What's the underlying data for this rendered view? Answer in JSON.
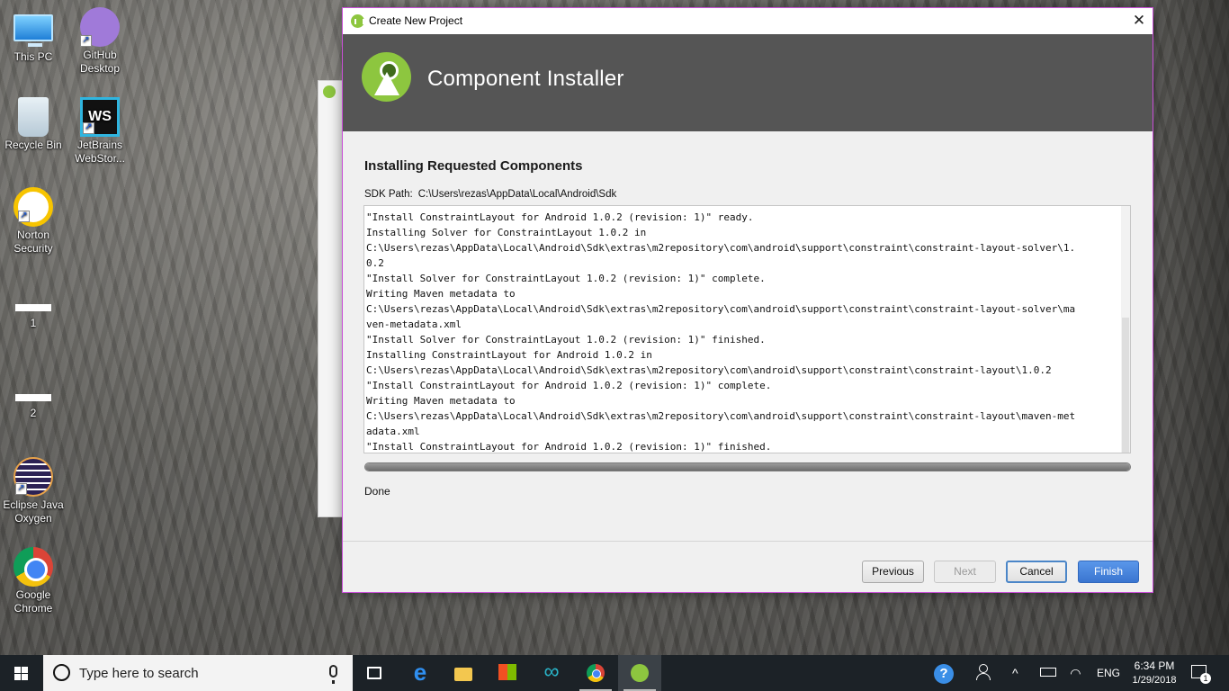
{
  "desktop": {
    "icons": [
      {
        "label": "This PC"
      },
      {
        "label": "GitHub Desktop"
      },
      {
        "label": "Recycle Bin"
      },
      {
        "label": "JetBrains WebStor..."
      },
      {
        "label": "Norton Security"
      },
      {
        "label": "1"
      },
      {
        "label": "2"
      },
      {
        "label": "Eclipse Java Oxygen"
      },
      {
        "label": "Google Chrome"
      }
    ]
  },
  "dialog": {
    "window_title": "Create New Project",
    "close_glyph": "✕",
    "banner_title": "Component Installer",
    "heading": "Installing Requested Components",
    "sdk_label": "SDK Path:",
    "sdk_path": "C:\\Users\\rezas\\AppData\\Local\\Android\\Sdk",
    "log_lines": [
      "\"Install ConstraintLayout for Android 1.0.2 (revision: 1)\" ready.",
      "Installing Solver for ConstraintLayout 1.0.2 in",
      "C:\\Users\\rezas\\AppData\\Local\\Android\\Sdk\\extras\\m2repository\\com\\android\\support\\constraint\\constraint-layout-solver\\1.",
      "0.2",
      "\"Install Solver for ConstraintLayout 1.0.2 (revision: 1)\" complete.",
      "Writing Maven metadata to",
      "C:\\Users\\rezas\\AppData\\Local\\Android\\Sdk\\extras\\m2repository\\com\\android\\support\\constraint\\constraint-layout-solver\\ma",
      "ven-metadata.xml",
      "\"Install Solver for ConstraintLayout 1.0.2 (revision: 1)\" finished.",
      "Installing ConstraintLayout for Android 1.0.2 in",
      "C:\\Users\\rezas\\AppData\\Local\\Android\\Sdk\\extras\\m2repository\\com\\android\\support\\constraint\\constraint-layout\\1.0.2",
      "\"Install ConstraintLayout for Android 1.0.2 (revision: 1)\" complete.",
      "Writing Maven metadata to",
      "C:\\Users\\rezas\\AppData\\Local\\Android\\Sdk\\extras\\m2repository\\com\\android\\support\\constraint\\constraint-layout\\maven-met",
      "adata.xml",
      "\"Install ConstraintLayout for Android 1.0.2 (revision: 1)\" finished."
    ],
    "progress_fraction": 1.0,
    "status": "Done",
    "buttons": {
      "previous": "Previous",
      "next": "Next",
      "cancel": "Cancel",
      "finish": "Finish"
    },
    "colors": {
      "banner": "#555555",
      "android_green": "#8dc63f",
      "finish_blue": "#3a75d0",
      "window_border": "#c94fd8"
    }
  },
  "taskbar": {
    "search_placeholder": "Type here to search",
    "pinned": [
      "task-view-icon",
      "edge-icon",
      "file-explorer-icon",
      "store-icon",
      "arduino-icon",
      "chrome-icon",
      "android-studio-icon"
    ],
    "tray": {
      "help_glyph": "?",
      "chevron": "^",
      "language": "ENG",
      "time": "6:34 PM",
      "date": "1/29/2018",
      "notification_count": "1"
    }
  }
}
